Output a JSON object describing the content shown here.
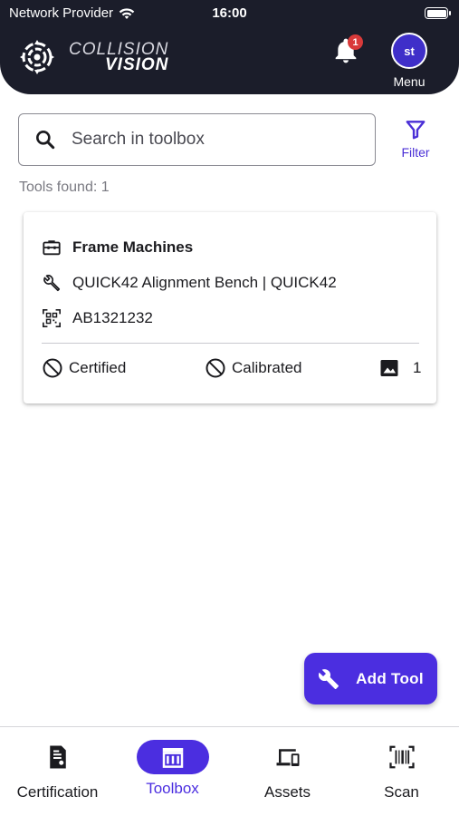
{
  "status_bar": {
    "carrier": "Network Provider",
    "time": "16:00"
  },
  "header": {
    "logo_line1": "COLLISION",
    "logo_line2": "VISION",
    "notification_count": "1",
    "avatar_initials": "st",
    "menu_label": "Menu"
  },
  "search": {
    "placeholder": "Search in toolbox",
    "value": ""
  },
  "filter_label": "Filter",
  "tools_found": "Tools found: 1",
  "tools": [
    {
      "category": "Frame Machines",
      "model": "QUICK42 Alignment Bench | QUICK42",
      "serial": "AB1321232",
      "certified_label": "Certified",
      "calibrated_label": "Calibrated",
      "image_count": "1"
    }
  ],
  "fab_label": "Add Tool",
  "bottom_nav": [
    {
      "label": "Certification",
      "icon": "certificate-icon"
    },
    {
      "label": "Toolbox",
      "icon": "toolbox-icon",
      "active": true
    },
    {
      "label": "Assets",
      "icon": "devices-icon"
    },
    {
      "label": "Scan",
      "icon": "barcode-scan-icon"
    }
  ],
  "colors": {
    "header_bg": "#1b1d2a",
    "accent": "#4b2ee0",
    "badge_red": "#d93a3a"
  }
}
